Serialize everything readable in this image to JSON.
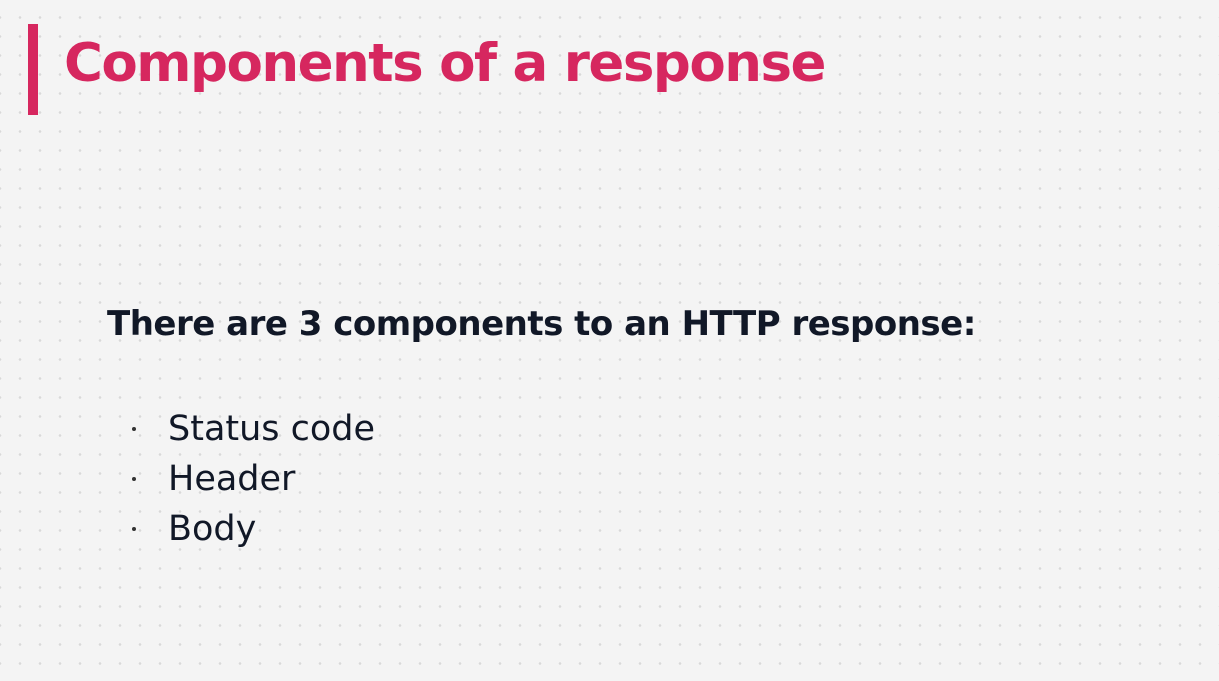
{
  "slide": {
    "title": "Components of a response",
    "intro": "There are 3 components to an HTTP response:",
    "bullets": [
      {
        "label": "Status code"
      },
      {
        "label": "Header"
      },
      {
        "label": "Body"
      }
    ]
  },
  "colors": {
    "accent": "#d6275f",
    "text": "#111827",
    "background": "#f4f4f4"
  }
}
